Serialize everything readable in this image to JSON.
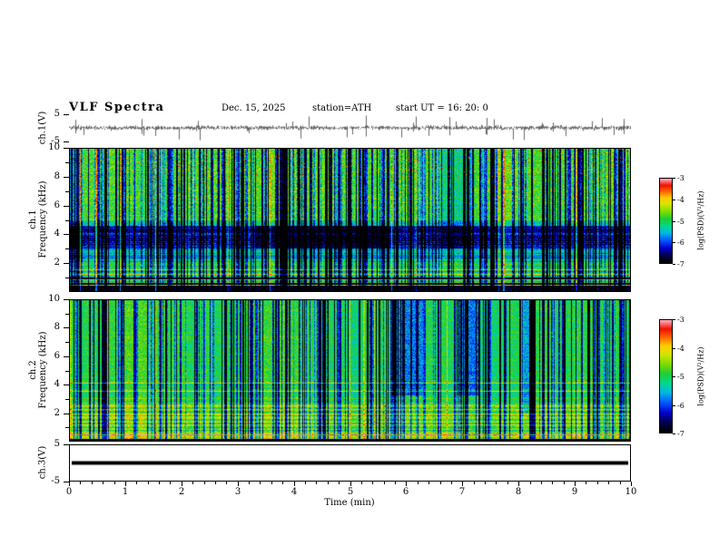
{
  "header": {
    "title": "VLF Spectra",
    "date": "Dec. 15, 2025",
    "station": "station=ATH",
    "start_ut": "start UT  =  16: 20: 0"
  },
  "axes": {
    "xlabel": "Time (min)",
    "xlim": [
      0,
      10
    ],
    "xticks": [
      0,
      1,
      2,
      3,
      4,
      5,
      6,
      7,
      8,
      9,
      10
    ]
  },
  "panels": {
    "ch1_wave": {
      "label": "ch.1(V)",
      "ylim": [
        -5,
        5
      ],
      "yticks": [
        5,
        -5
      ]
    },
    "ch1_spec": {
      "label_line1": "ch.1",
      "label_line2": "Frequency (kHz)",
      "ylim": [
        0,
        10
      ],
      "yticks": [
        10,
        8,
        6,
        4,
        2
      ],
      "yticks_minor": [
        9,
        7,
        5,
        3,
        1
      ]
    },
    "ch2_spec": {
      "label_line1": "ch.2",
      "label_line2": "Frequency (kHz)",
      "ylim": [
        0,
        10
      ],
      "yticks": [
        10,
        8,
        6,
        4,
        2
      ],
      "yticks_minor": [
        9,
        7,
        5,
        3,
        1
      ]
    },
    "ch3_wave": {
      "label": "ch.3(V)",
      "ylim": [
        -5,
        5
      ],
      "yticks": [
        5,
        -5
      ]
    }
  },
  "colorbar": {
    "label": "log(PSD)(V²/Hz)",
    "ticks": [
      -3,
      -4,
      -5,
      -6,
      -7
    ],
    "range": [
      -7,
      -3
    ],
    "stops": [
      {
        "v": -7.0,
        "c": "#000000"
      },
      {
        "v": -6.65,
        "c": "#00004d"
      },
      {
        "v": -6.3,
        "c": "#0000cc"
      },
      {
        "v": -5.95,
        "c": "#0055ff"
      },
      {
        "v": -5.6,
        "c": "#00b4e6"
      },
      {
        "v": -5.25,
        "c": "#00d98c"
      },
      {
        "v": -4.9,
        "c": "#22cc33"
      },
      {
        "v": -4.55,
        "c": "#7fdd00"
      },
      {
        "v": -4.2,
        "c": "#d4e600"
      },
      {
        "v": -3.9,
        "c": "#ffcc00"
      },
      {
        "v": -3.6,
        "c": "#ff6600"
      },
      {
        "v": -3.3,
        "c": "#ee1100"
      },
      {
        "v": -3.0,
        "c": "#ffaabb"
      }
    ]
  },
  "chart_data": [
    {
      "type": "line",
      "name": "ch1_waveform",
      "ylabel": "ch.1(V)",
      "ylim": [
        -5,
        5
      ],
      "xlim": [
        0,
        10
      ],
      "summary": "broadband noise around 0 V (~±1 V) with frequent impulsive spikes reaching about ±4 V across the full 10 minutes",
      "seed": 9,
      "noise_sigma": 0.5,
      "spike_prob": 0.05,
      "spike_amp": 3.6
    },
    {
      "type": "heatmap",
      "name": "ch1_spectrogram",
      "ylabel": "Frequency (kHz)",
      "ylim": [
        0,
        10
      ],
      "xlim": [
        0,
        10
      ],
      "value_range": [
        -7,
        -3
      ],
      "summary": "green/yellow hiss above 5 kHz with red flecks near 10 kHz, strong blue attenuation band 3-4.6 kHz, layered horizontal lines below 2 kHz, black band below 0.4 kHz, dense dark vertical sferic streaks",
      "seed": 11,
      "bands": [
        {
          "f0": 5.0,
          "f1": 10.0,
          "base": -4.75,
          "noise": 0.5,
          "rowvar": 0.12
        },
        {
          "f0": 4.6,
          "f1": 5.0,
          "base": -5.3,
          "noise": 0.4,
          "rowvar": 0.2
        },
        {
          "f0": 3.0,
          "f1": 4.6,
          "base": -6.3,
          "noise": 0.4,
          "rowvar": 0.35
        },
        {
          "f0": 2.2,
          "f1": 3.0,
          "base": -5.5,
          "noise": 0.35,
          "rowvar": 0.4
        },
        {
          "f0": 1.2,
          "f1": 2.2,
          "base": -5.1,
          "noise": 0.45,
          "rowvar": 0.5
        },
        {
          "f0": 0.4,
          "f1": 1.2,
          "base": -4.8,
          "noise": 0.4,
          "rowvar": 0.8
        },
        {
          "f0": 0.0,
          "f1": 0.4,
          "base": -6.9,
          "noise": 0.15,
          "rowvar": 0.1
        }
      ],
      "hlines": [
        {
          "f": 1.5,
          "v": -3.9,
          "t": 1
        },
        {
          "f": 0.95,
          "v": -6.9,
          "t": 2
        },
        {
          "f": 0.55,
          "v": -6.9,
          "t": 2
        },
        {
          "f": 2.5,
          "v": -5.9,
          "t": 1
        }
      ],
      "patches": [
        {
          "t0": 3.3,
          "t1": 5.7,
          "f0": 3.0,
          "f1": 4.6,
          "dv": -0.5
        },
        {
          "t0": 6.6,
          "t1": 7.1,
          "f0": 3.0,
          "f1": 10.0,
          "dv": -0.5
        }
      ],
      "streaks": {
        "count": 300,
        "min_drop": 0.8,
        "max_drop": 2.6,
        "bright_count": 18,
        "bright_rise": 0.9
      },
      "specks": {
        "fmin": 8.0,
        "prob": 0.01,
        "v": -3.4
      }
    },
    {
      "type": "heatmap",
      "name": "ch2_spectrogram",
      "ylabel": "Frequency (kHz)",
      "ylim": [
        0,
        10
      ],
      "xlim": [
        0,
        10
      ],
      "value_range": [
        -7,
        -3
      ],
      "summary": "fairly uniform green hiss above 4.5 kHz with blue vertical streaks and darker patches near 6 and 7 min, yellow/orange horizontal lines between 1 and 4.2 kHz, bright band below 0.6 kHz, thin black band at 0 kHz",
      "seed": 23,
      "bands": [
        {
          "f0": 4.5,
          "f1": 10.0,
          "base": -4.95,
          "noise": 0.38,
          "rowvar": 0.1
        },
        {
          "f0": 3.2,
          "f1": 4.5,
          "base": -5.0,
          "noise": 0.4,
          "rowvar": 0.3
        },
        {
          "f0": 2.6,
          "f1": 3.2,
          "base": -4.9,
          "noise": 0.35,
          "rowvar": 0.35
        },
        {
          "f0": 1.6,
          "f1": 2.6,
          "base": -4.55,
          "noise": 0.4,
          "rowvar": 0.45
        },
        {
          "f0": 0.6,
          "f1": 1.6,
          "base": -4.7,
          "noise": 0.4,
          "rowvar": 0.55
        },
        {
          "f0": 0.15,
          "f1": 0.6,
          "base": -4.25,
          "noise": 0.35,
          "rowvar": 0.3
        },
        {
          "f0": 0.0,
          "f1": 0.15,
          "base": -6.9,
          "noise": 0.12,
          "rowvar": 0.1
        }
      ],
      "hlines": [
        {
          "f": 4.15,
          "v": -3.85,
          "t": 1
        },
        {
          "f": 3.55,
          "v": -4.0,
          "t": 1
        },
        {
          "f": 2.25,
          "v": -3.8,
          "t": 1
        },
        {
          "f": 1.95,
          "v": -3.95,
          "t": 1
        },
        {
          "f": 1.15,
          "v": -4.05,
          "t": 1
        },
        {
          "f": 0.45,
          "v": -3.1,
          "t": 1
        }
      ],
      "patches": [
        {
          "t0": 5.75,
          "t1": 6.3,
          "f0": 3.2,
          "f1": 10.0,
          "dv": -0.8
        },
        {
          "t0": 6.9,
          "t1": 7.3,
          "f0": 3.2,
          "f1": 10.0,
          "dv": -0.7
        },
        {
          "t0": 8.1,
          "t1": 8.3,
          "f0": 2.0,
          "f1": 10.0,
          "dv": -0.6
        }
      ],
      "streaks": {
        "count": 230,
        "min_drop": 0.7,
        "max_drop": 2.2,
        "bright_count": 10,
        "bright_rise": 0.7
      },
      "specks": {
        "fmin": 8.5,
        "prob": 0.004,
        "v": -3.5
      }
    },
    {
      "type": "line",
      "name": "ch3_waveform",
      "ylabel": "ch.3(V)",
      "ylim": [
        -5,
        5
      ],
      "xlim": [
        0,
        10
      ],
      "summary": "constant 0 V flat thick line (channel inactive)",
      "value": 0
    }
  ]
}
